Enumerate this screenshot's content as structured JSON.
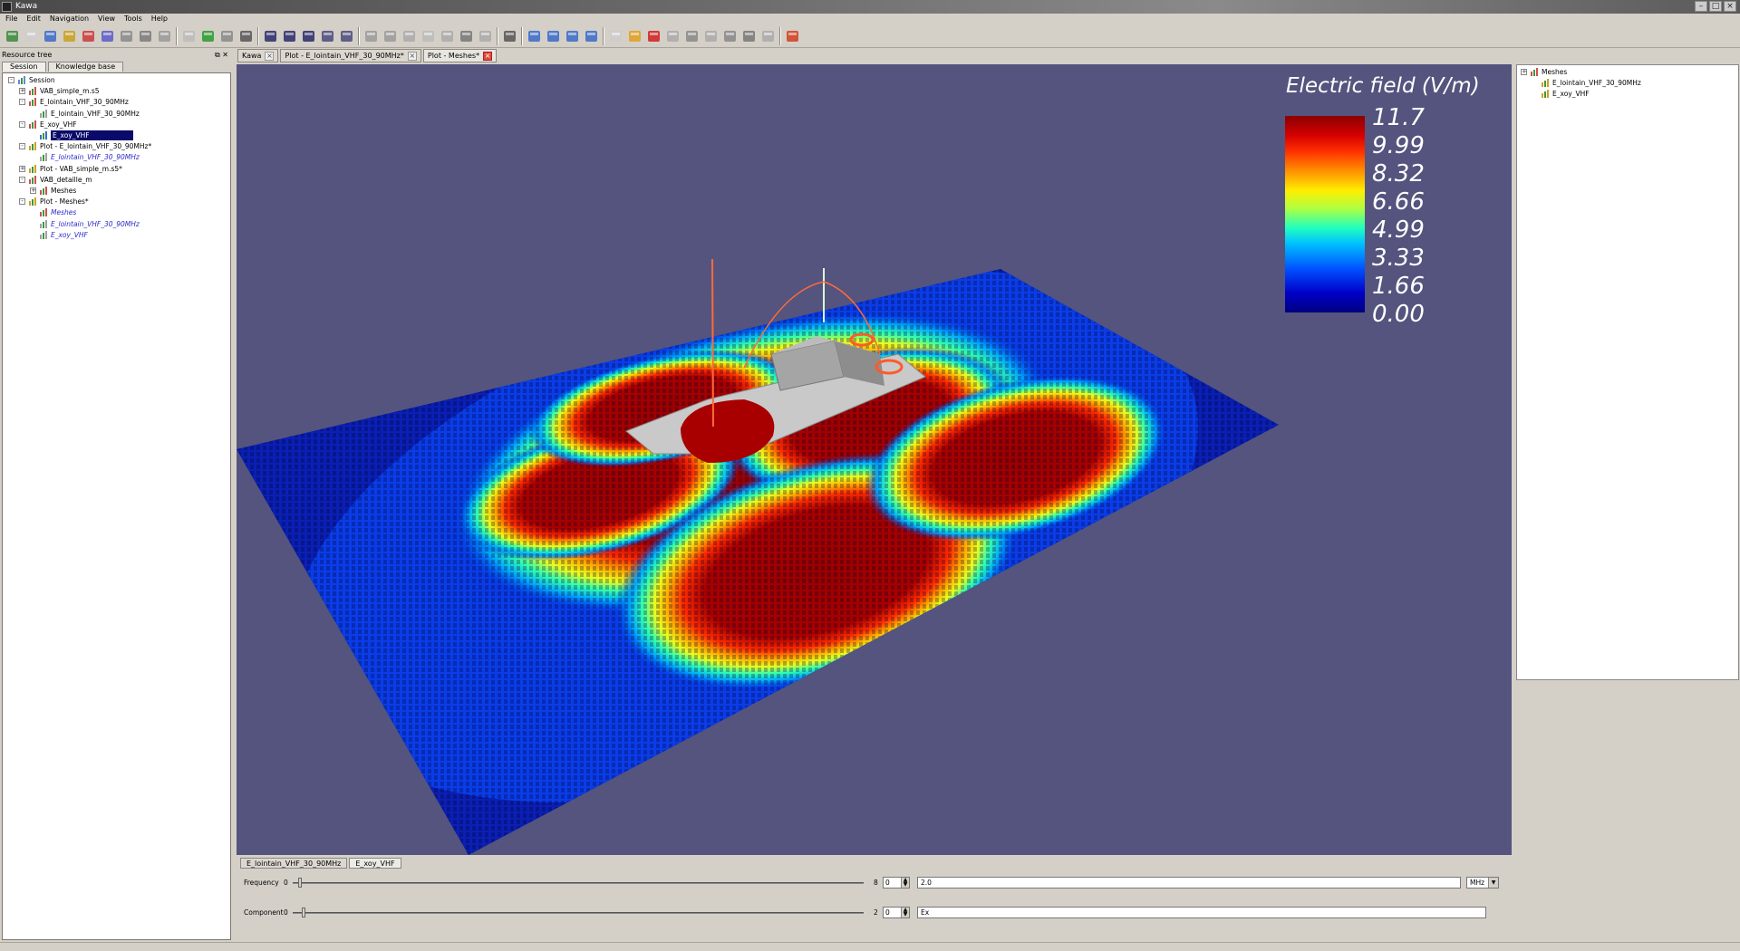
{
  "window": {
    "title": "Kawa"
  },
  "menu": [
    "File",
    "Edit",
    "Navigation",
    "View",
    "Tools",
    "Help"
  ],
  "toolbar": {
    "icons": [
      "new-session-icon",
      "blank-icon",
      "image-icon",
      "bar-chart-icon",
      "pdf-icon",
      "link-icon",
      "mesh-icon",
      "database-icon",
      "cube-icon",
      "document-icon",
      "download-icon",
      "document-d-icon",
      "delete-icon",
      "save-icon",
      "save-as-icon",
      "save-all-icon",
      "save-copy-icon",
      "save-d-icon",
      "undo-icon",
      "redo-icon",
      "pointer-icon",
      "copy-icon",
      "paste-icon",
      "stop-icon",
      "pipe-icon",
      "home-icon",
      "measure-icon",
      "zoom-in-icon",
      "zoom-fit-icon",
      "zoom-out-icon",
      "frame-icon",
      "folder-icon",
      "close-x-icon",
      "layers-icon",
      "add-icon",
      "up-arrow-icon",
      "minus-icon",
      "down-arrow-icon",
      "star-icon",
      "lifebuoy-icon"
    ]
  },
  "left_panel": {
    "title": "Resource tree",
    "tabs": [
      "Session",
      "Knowledge base"
    ],
    "tree": [
      {
        "label": "Session",
        "depth": 0,
        "expander": "-",
        "icon": "session-icon"
      },
      {
        "label": "VAB_simple_m.s5",
        "depth": 1,
        "expander": "+",
        "icon": "mesh-icon"
      },
      {
        "label": "E_lointain_VHF_30_90MHz",
        "depth": 1,
        "expander": "-",
        "icon": "mesh-icon"
      },
      {
        "label": "E_lointain_VHF_30_90MHz",
        "depth": 2,
        "expander": "",
        "icon": "field-icon"
      },
      {
        "label": "E_xoy_VHF",
        "depth": 1,
        "expander": "-",
        "icon": "mesh-icon"
      },
      {
        "label": "E_xoy_VHF",
        "depth": 2,
        "expander": "",
        "icon": "globe-icon",
        "selected": true
      },
      {
        "label": "Plot - E_lointain_VHF_30_90MHz*",
        "depth": 1,
        "expander": "-",
        "icon": "plot-icon"
      },
      {
        "label": "E_lointain_VHF_30_90MHz",
        "depth": 2,
        "expander": "",
        "icon": "field-icon",
        "italic": true
      },
      {
        "label": "Plot - VAB_simple_m.s5*",
        "depth": 1,
        "expander": "+",
        "icon": "plot-icon"
      },
      {
        "label": "VAB_detaille_m",
        "depth": 1,
        "expander": "-",
        "icon": "mesh-icon"
      },
      {
        "label": "Meshes",
        "depth": 2,
        "expander": "+",
        "icon": "mesh-icon"
      },
      {
        "label": "Plot - Meshes*",
        "depth": 1,
        "expander": "-",
        "icon": "plot-icon"
      },
      {
        "label": "Meshes",
        "depth": 2,
        "expander": "",
        "icon": "mesh-icon",
        "italic": true
      },
      {
        "label": "E_lointain_VHF_30_90MHz",
        "depth": 2,
        "expander": "",
        "icon": "field-icon",
        "italic": true
      },
      {
        "label": "E_xoy_VHF",
        "depth": 2,
        "expander": "",
        "icon": "field-icon",
        "italic": true
      }
    ]
  },
  "doc_tabs": [
    {
      "label": "Kawa",
      "active": false
    },
    {
      "label": "Plot - E_lointain_VHF_30_90MHz*",
      "active": false
    },
    {
      "label": "Plot - Meshes*",
      "active": true
    }
  ],
  "viewport": {
    "background": "#54547e",
    "legend": {
      "title": "Electric field (V/m)",
      "ticks": [
        "11.7",
        "9.99",
        "8.32",
        "6.66",
        "4.99",
        "3.33",
        "1.66",
        "0.00"
      ]
    }
  },
  "right_panel": {
    "tree": [
      {
        "label": "Meshes",
        "depth": 0,
        "expander": "+",
        "icon": "mesh-icon"
      },
      {
        "label": "E_lointain_VHF_30_90MHz",
        "depth": 1,
        "expander": "",
        "icon": "plot-icon"
      },
      {
        "label": "E_xoy_VHF",
        "depth": 1,
        "expander": "",
        "icon": "plot-icon"
      }
    ]
  },
  "bottom": {
    "tabs": [
      {
        "label": "E_lointain_VHF_30_90MHz",
        "active": false
      },
      {
        "label": "E_xoy_VHF",
        "active": true
      }
    ],
    "frequency": {
      "label": "Frequency",
      "min": "0",
      "max": "8",
      "index": "0",
      "value": "2.0",
      "unit": "MHz"
    },
    "component": {
      "label": "Component",
      "min": "0",
      "max": "2",
      "index": "0",
      "value": "Ex"
    }
  }
}
